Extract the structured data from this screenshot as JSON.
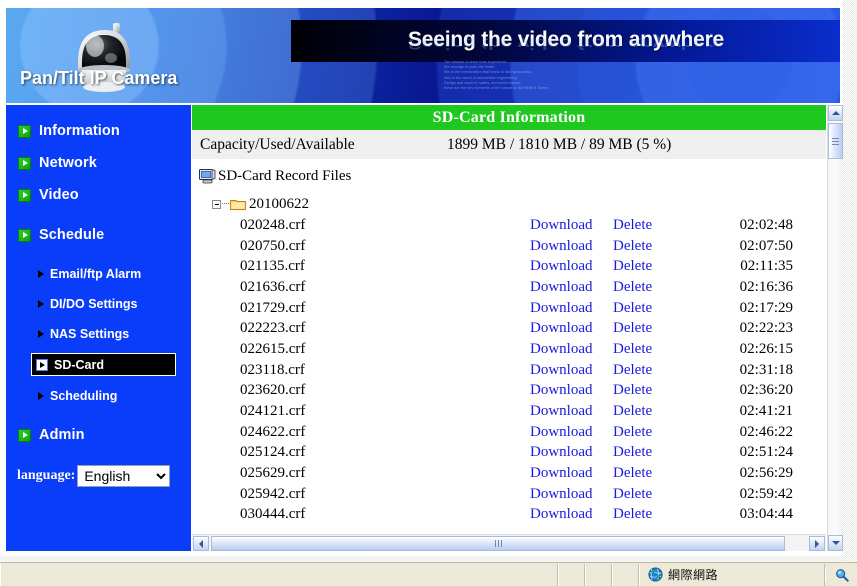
{
  "banner": {
    "product_name": "Pan/Tilt IP Camera",
    "slogan": "Seeing the video from anywhere",
    "blurb": "The wisdom to learn from experience,\nthe courage to push the limits:\nthis is the combination that leads to lasting success,\nalso in the world of automotive engineering.\nDesign and comfort, safety, and performance -\nthese are the key elements of the nature of the BMW 5 Series.",
    "camera_icon": "ptz-camera-icon"
  },
  "sidebar": {
    "main_items": [
      {
        "label": "Information",
        "icon": "green-arrow-icon",
        "selected": false
      },
      {
        "label": "Network",
        "icon": "green-arrow-icon",
        "selected": false
      },
      {
        "label": "Video",
        "icon": "green-arrow-icon",
        "selected": false
      },
      {
        "label": "Schedule",
        "icon": "green-arrow-icon",
        "selected": false
      }
    ],
    "sub_items": [
      {
        "label": "Email/ftp Alarm",
        "icon": "triangle-right-icon",
        "selected": false
      },
      {
        "label": "DI/DO Settings",
        "icon": "triangle-right-icon",
        "selected": false
      },
      {
        "label": "NAS Settings",
        "icon": "triangle-right-icon",
        "selected": false
      },
      {
        "label": "SD-Card",
        "icon": "triangle-right-icon",
        "selected": true
      },
      {
        "label": "Scheduling",
        "icon": "triangle-right-icon",
        "selected": false
      }
    ],
    "admin_item": {
      "label": "Admin",
      "icon": "green-arrow-icon"
    },
    "language": {
      "label": "language:",
      "selected": "English",
      "options": [
        "English"
      ]
    }
  },
  "main": {
    "section_title": "SD-Card Information",
    "capacity": {
      "label": "Capacity/Used/Available",
      "value": "1899 MB / 1810 MB / 89 MB (5 %)"
    },
    "record_files": {
      "label": "SD-Card Record Files",
      "icon": "computer-icon"
    },
    "folder": {
      "name": "20100622",
      "icon": "folder-icon",
      "expanded": true,
      "toggle_icon": "tree-collapse-icon"
    },
    "action_labels": {
      "download": "Download",
      "delete": "Delete"
    },
    "files": [
      {
        "name": "020248.crf",
        "download": "Download",
        "delete": "Delete",
        "time": "02:02:48"
      },
      {
        "name": "020750.crf",
        "download": "Download",
        "delete": "Delete",
        "time": "02:07:50"
      },
      {
        "name": "021135.crf",
        "download": "Download",
        "delete": "Delete",
        "time": "02:11:35"
      },
      {
        "name": "021636.crf",
        "download": "Download",
        "delete": "Delete",
        "time": "02:16:36"
      },
      {
        "name": "021729.crf",
        "download": "Download",
        "delete": "Delete",
        "time": "02:17:29"
      },
      {
        "name": "022223.crf",
        "download": "Download",
        "delete": "Delete",
        "time": "02:22:23"
      },
      {
        "name": "022615.crf",
        "download": "Download",
        "delete": "Delete",
        "time": "02:26:15"
      },
      {
        "name": "023118.crf",
        "download": "Download",
        "delete": "Delete",
        "time": "02:31:18"
      },
      {
        "name": "023620.crf",
        "download": "Download",
        "delete": "Delete",
        "time": "02:36:20"
      },
      {
        "name": "024121.crf",
        "download": "Download",
        "delete": "Delete",
        "time": "02:41:21"
      },
      {
        "name": "024622.crf",
        "download": "Download",
        "delete": "Delete",
        "time": "02:46:22"
      },
      {
        "name": "025124.crf",
        "download": "Download",
        "delete": "Delete",
        "time": "02:51:24"
      },
      {
        "name": "025629.crf",
        "download": "Download",
        "delete": "Delete",
        "time": "02:56:29"
      },
      {
        "name": "025942.crf",
        "download": "Download",
        "delete": "Delete",
        "time": "02:59:42"
      },
      {
        "name": "030444.crf",
        "download": "Download",
        "delete": "Delete",
        "time": "03:04:44"
      }
    ]
  },
  "scrollbars": {
    "vertical": {
      "up_icon": "scroll-up-icon",
      "down_icon": "scroll-down-icon"
    },
    "horizontal": {
      "left_icon": "scroll-left-icon",
      "right_icon": "scroll-right-icon"
    }
  },
  "statusbar": {
    "zone_label": "網際網路",
    "zone_icon": "globe-icon",
    "zoom_icon": "magnifier-icon"
  },
  "colors": {
    "sidebar_bg": "#0a3dfa",
    "section_header_green": "#1ec81e",
    "link_blue": "#1a1ae0",
    "capacity_row_bg": "#efefef",
    "statusbar_bg": "#ece9d8"
  }
}
